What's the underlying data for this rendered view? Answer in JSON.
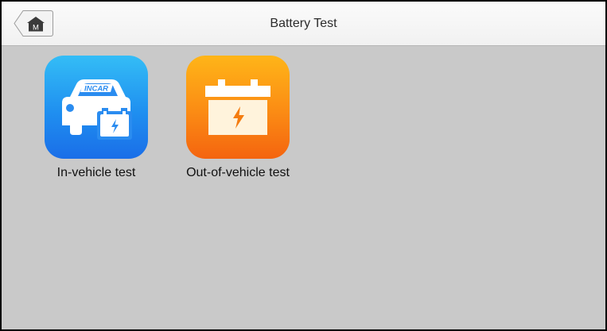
{
  "header": {
    "title": "Battery Test",
    "home_button_glyph": "M",
    "home_icon": "home-icon"
  },
  "tiles": [
    {
      "label": "In-vehicle test",
      "badge": "INCAR",
      "icon": "car-battery-icon",
      "gradient": [
        "#34bdf6",
        "#1a6ee8"
      ]
    },
    {
      "label": "Out-of-vehicle test",
      "icon": "battery-icon",
      "gradient": [
        "#ffb518",
        "#f4640f"
      ]
    }
  ],
  "colors": {
    "background": "#c9c9c9",
    "titlebar": "#f4f4f4"
  }
}
